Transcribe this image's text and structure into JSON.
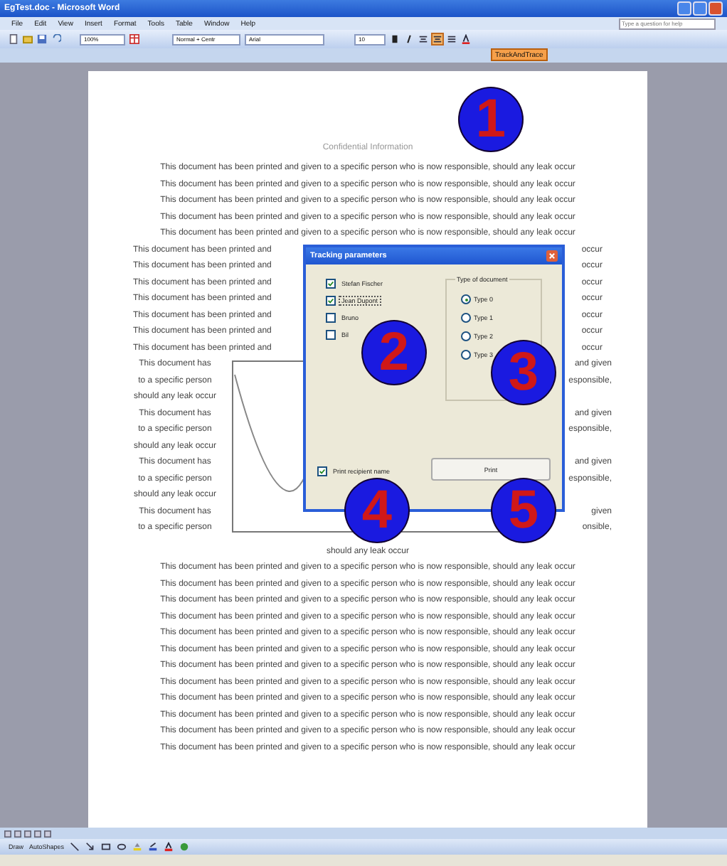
{
  "window": {
    "title": "EgTest.doc - Microsoft Word"
  },
  "menu": [
    "File",
    "Edit",
    "View",
    "Insert",
    "Format",
    "Tools",
    "Table",
    "Window",
    "Help"
  ],
  "help_search": {
    "placeholder": "Type a question for help"
  },
  "toolbar": {
    "zoom": "100%",
    "style": "Normal + Centr",
    "font": "Arial",
    "size": "10"
  },
  "addin_button": "TrackAndTrace",
  "document": {
    "header": "Confidential Information",
    "lines_top": [
      "This document has been printed and given to a specific person who is now responsible, should any leak occur",
      "This document has been printed and given to a specific person who is now responsible, should any leak occur",
      "This document has been printed and given to a specific person who is now responsible, should any leak occur",
      "This document has been printed and given to a specific person who is now responsible, should any leak occur",
      "This document has been printed and given to a specific person who is now responsible, should any leak occur"
    ],
    "split_lines": [
      {
        "left": "This document has been printed and",
        "right": "occur"
      },
      {
        "left": "This document has been printed and",
        "right": "occur"
      },
      {
        "left": "This document has been printed and",
        "right": "occur"
      },
      {
        "left": "This document has been printed and",
        "right": "occur"
      },
      {
        "left": "This document has been printed and",
        "right": "occur"
      },
      {
        "left": "This document has been printed and",
        "right": "occur"
      },
      {
        "left": "This document has been printed and",
        "right": "occur"
      }
    ],
    "wrap_rows": [
      {
        "left": "This document has",
        "right": "and given"
      },
      {
        "left": "to a specific person",
        "right": "esponsible,"
      },
      {
        "left": "should any leak occur"
      },
      {
        "left": "This document has",
        "right": "and given"
      },
      {
        "left": "to a specific person",
        "right": "esponsible,"
      },
      {
        "left": "should any leak occur"
      },
      {
        "left": "This document has",
        "right": "and given"
      },
      {
        "left": "to a specific person",
        "right": "esponsible,"
      },
      {
        "left": "should any leak occur"
      },
      {
        "left": "This document has",
        "right": "given"
      },
      {
        "left": "to a specific person",
        "right": "onsible,"
      }
    ],
    "caption": "should any leak occur",
    "lines_bottom": [
      "This document has been printed and given to a specific person who is now responsible, should any leak occur",
      "This document has been printed and given to a specific person who is now responsible, should any leak occur",
      "This document has been printed and given to a specific person who is now responsible, should any leak occur",
      "This document has been printed and given to a specific person who is now responsible, should any leak occur",
      "This document has been printed and given to a specific person who is now responsible, should any leak occur",
      "This document has been printed and given to a specific person who is now responsible, should any leak occur",
      "This document has been printed and given to a specific person who is now responsible, should any leak occur",
      "This document has been printed and given to a specific person who is now responsible, should any leak occur",
      "This document has been printed and given to a specific person who is now responsible, should any leak occur",
      "This document has been printed and given to a specific person who is now responsible, should any leak occur",
      "This document has been printed and given to a specific person who is now responsible, should any leak occur",
      "This document has been printed and given to a specific person who is now responsible, should any leak occur"
    ]
  },
  "dialog": {
    "title": "Tracking parameters",
    "recipients": [
      {
        "label": "Stefan Fischer",
        "checked": true,
        "focused": false
      },
      {
        "label": "Jean Dupont",
        "checked": true,
        "focused": true
      },
      {
        "label": "Bruno",
        "checked": false,
        "focused": false
      },
      {
        "label": "Bil",
        "checked": false,
        "focused": false
      }
    ],
    "group_title": "Type of document",
    "types": [
      {
        "label": "Type 0",
        "selected": true
      },
      {
        "label": "Type 1",
        "selected": false
      },
      {
        "label": "Type 2",
        "selected": false
      },
      {
        "label": "Type 3",
        "selected": false
      }
    ],
    "print_name": {
      "label": "Print recipient name",
      "checked": true
    },
    "button": "Print"
  },
  "callouts": [
    "1",
    "2",
    "3",
    "4",
    "5"
  ],
  "drawing_toolbar": {
    "draw": "Draw",
    "autoshapes": "AutoShapes"
  }
}
